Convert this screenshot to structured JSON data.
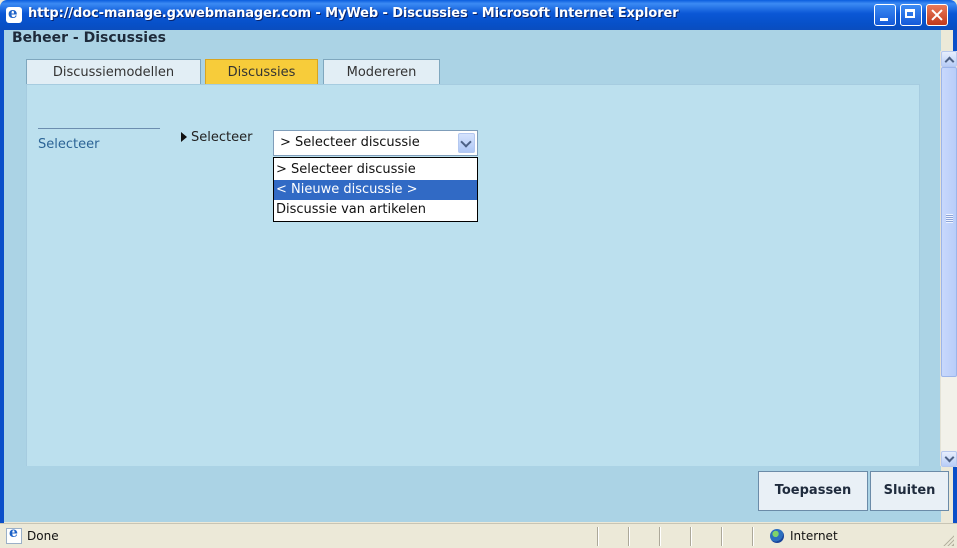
{
  "window": {
    "title": "http://doc-manage.gxwebmanager.com - MyWeb - Discussies - Microsoft Internet Explorer"
  },
  "page": {
    "title": "Beheer - Discussies"
  },
  "tabs": [
    {
      "label": "Discussiemodellen",
      "active": false
    },
    {
      "label": "Discussies",
      "active": true
    },
    {
      "label": "Modereren",
      "active": false
    }
  ],
  "sidebar": {
    "link_label": "Selecteer"
  },
  "form": {
    "field_label": "Selecteer",
    "select_value": "> Selecteer discussie",
    "options": [
      {
        "label": "> Selecteer discussie",
        "highlighted": false
      },
      {
        "label": "< Nieuwe discussie >",
        "highlighted": true
      },
      {
        "label": "Discussie van artikelen",
        "highlighted": false
      }
    ]
  },
  "buttons": {
    "apply": "Toepassen",
    "close": "Sluiten"
  },
  "statusbar": {
    "status": "Done",
    "zone": "Internet"
  },
  "colors": {
    "content_bg": "#ABD3E5",
    "active_tab": "#F7CC3A",
    "selection": "#316AC5"
  }
}
